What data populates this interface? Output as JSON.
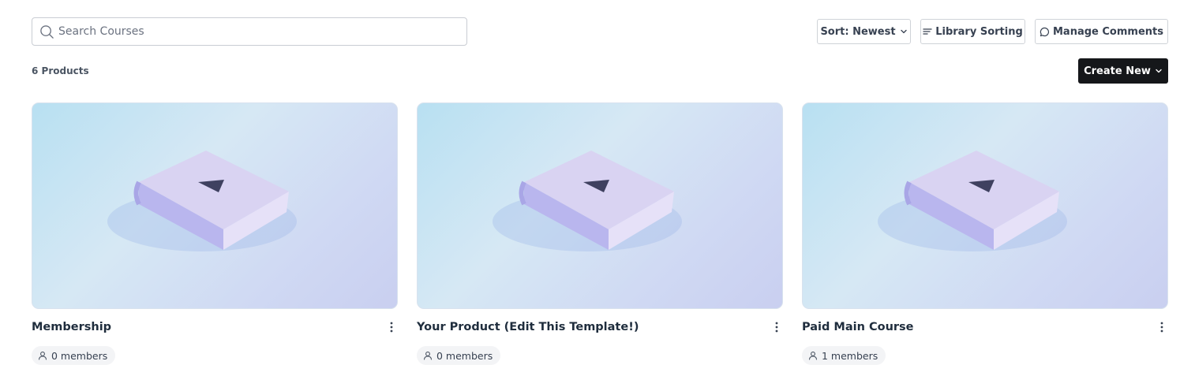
{
  "search": {
    "placeholder": "Search Courses",
    "value": ""
  },
  "toolbar": {
    "sort_label": "Sort: Newest",
    "library_sorting_label": "Library Sorting",
    "manage_comments_label": "Manage Comments"
  },
  "summary": {
    "count_label": "6 Products"
  },
  "create": {
    "label": "Create New"
  },
  "products": [
    {
      "title": "Membership",
      "members": "0 members"
    },
    {
      "title": "Your Product (Edit This Template!)",
      "members": "0 members"
    },
    {
      "title": "Paid Main Course",
      "members": "1 members"
    }
  ],
  "icons": {
    "search": "search-icon",
    "sort": "chevron-down-icon",
    "library": "list-lines-icon",
    "comments": "chat-bubble-icon",
    "create": "chevron-down-icon",
    "more": "more-vertical-icon",
    "members": "user-icon"
  },
  "colors": {
    "primary_button": "#15171a",
    "border": "#cfd3d8",
    "thumbnail_bg": "#cfe3f3",
    "book": "#d9d3f2"
  }
}
